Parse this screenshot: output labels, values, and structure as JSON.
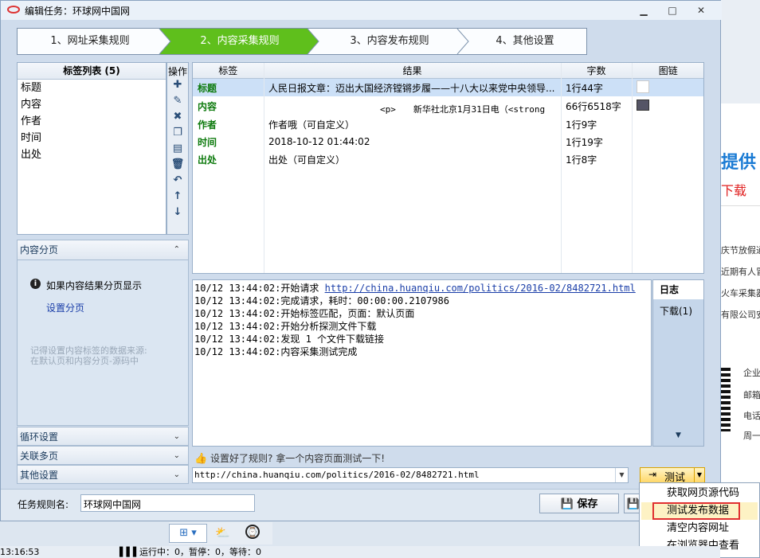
{
  "window": {
    "title": "编辑任务：环球网中国网",
    "minimize": "▁",
    "maximize": "□",
    "close": "✕"
  },
  "steps": [
    "1、网址采集规则",
    "2、内容采集规则",
    "3、内容发布规则",
    "4、其他设置"
  ],
  "tag_list": {
    "header": "标签列表 (5)",
    "ops_header": "操作",
    "items": [
      "标题",
      "内容",
      "作者",
      "时间",
      "出处"
    ]
  },
  "results": {
    "columns": [
      "标签",
      "结果",
      "字数",
      "图链"
    ],
    "rows": [
      {
        "tag": "标题",
        "value": "人民日报文章：迈出大国经济镗锵步履——十八大以来党中央领导...",
        "count": "1行44字"
      },
      {
        "tag": "内容",
        "value": "<p>　　新华社北京1月31日电（<strong",
        "count": "66行6518字"
      },
      {
        "tag": "作者",
        "value": "作者哦（可自定义）",
        "count": "1行9字"
      },
      {
        "tag": "时间",
        "value": "2018-10-12 01:44:02",
        "count": "1行19字"
      },
      {
        "tag": "出处",
        "value": "出处（可自定义）",
        "count": "1行8字"
      }
    ]
  },
  "pagination": {
    "header": "内容分页",
    "info": "如果内容结果分页显示",
    "link": "设置分页",
    "hint_line1": "记得设置内容标签的数据来源:",
    "hint_line2": "在默认页和内容分页-源码中"
  },
  "sections": [
    "循环设置",
    "关联多页",
    "其他设置"
  ],
  "log": {
    "lines": [
      {
        "time": "10/12 13:44:02:",
        "text": "开始请求 ",
        "link": "http://china.huanqiu.com/politics/2016-02/8482721.html"
      },
      {
        "time": "10/12 13:44:02:",
        "text": "完成请求，耗时：00:00:00.2107986",
        "link": ""
      },
      {
        "time": "10/12 13:44:02:",
        "text": "开始标签匹配，页面：默认页面",
        "link": ""
      },
      {
        "time": "10/12 13:44:02:",
        "text": "开始分析探测文件下载",
        "link": ""
      },
      {
        "time": "10/12 13:44:02:",
        "text": "发现 1 个文件下载链接",
        "link": ""
      },
      {
        "time": "10/12 13:44:02:",
        "text": "内容采集测试完成",
        "link": ""
      }
    ],
    "tab_log": "日志",
    "tab_download": "下载(1)"
  },
  "test": {
    "hint": "设置好了规则? 拿一个内容页面测试一下!",
    "url": "http://china.huanqiu.com/politics/2016-02/8482721.html",
    "button": "测试"
  },
  "footer": {
    "task_name_label": "任务规则名:",
    "task_name": "环球网中国网",
    "save": "保存"
  },
  "dropdown": {
    "items": [
      "获取网页源代码",
      "测试发布数据",
      "清空内容网址",
      "在浏览器中查看"
    ],
    "highlighted": 1
  },
  "statusbar": {
    "time": "13:16:53",
    "running": "运行中：0，暂停：0，等待：0"
  },
  "background": {
    "big": "提供",
    "red": "下载",
    "lines": [
      "庆节放假通",
      "近期有人冒",
      "火车采集器",
      "有限公司安"
    ],
    "right_lines": [
      "企业",
      "邮箱",
      "电话",
      "周一"
    ]
  },
  "colors": {
    "active_step": "#5fbf1c",
    "tag_text": "#0d7a0d",
    "selected_row": "#cce0f7",
    "highlight_border": "#e03030"
  }
}
